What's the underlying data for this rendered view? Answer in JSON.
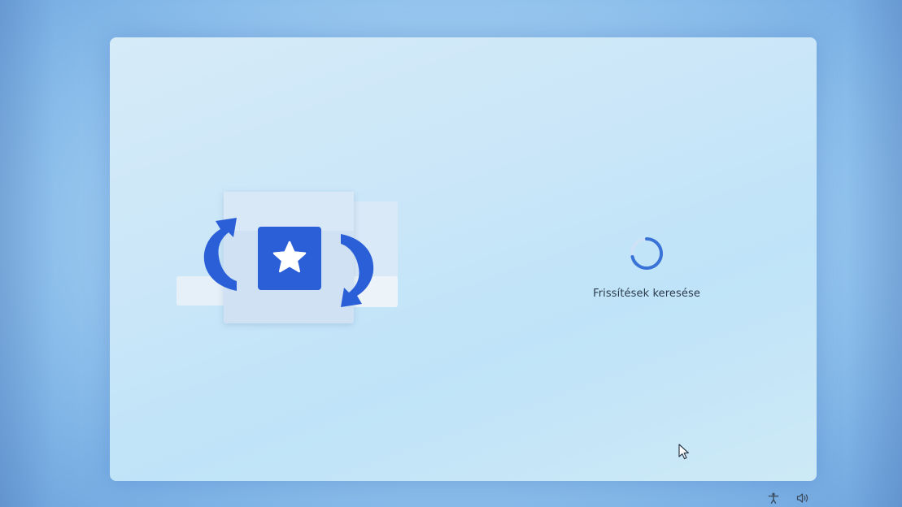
{
  "setup": {
    "status_text": "Frissítések keresése"
  },
  "colors": {
    "accent": "#2b5fd8",
    "spinner_track": "#cfe2f5",
    "spinner_arc": "#3a73d8",
    "text": "#2a3a4a"
  },
  "icons": {
    "illustration": "update-star-illustration",
    "spinner": "loading-spinner",
    "cursor": "mouse-pointer",
    "accessibility": "accessibility-icon",
    "volume": "volume-icon"
  }
}
